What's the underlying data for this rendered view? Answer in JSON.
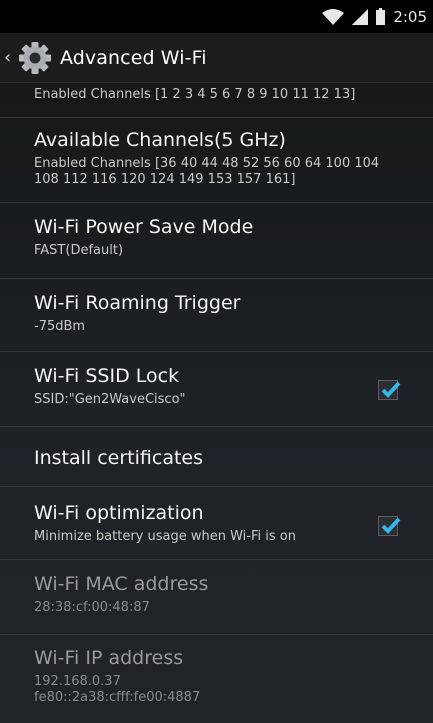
{
  "status": {
    "time": "2:05",
    "icons": [
      "wifi-icon",
      "signal-icon",
      "battery-icon"
    ]
  },
  "actionbar": {
    "title": "Advanced Wi-Fi",
    "icon": "settings-gear-icon"
  },
  "colors": {
    "accent": "#33b5e5",
    "background": "#1b1e22"
  },
  "settings": [
    {
      "title": "",
      "summary": "Enabled Channels [1 2 3 4 5 6 7 8 9 10 11 12 13]"
    },
    {
      "title": "Available Channels(5 GHz)",
      "summary": "Enabled Channels [36 40 44 48 52 56 60 64 100 104 108 112 116 120 124 149 153 157 161]"
    },
    {
      "title": "Wi-Fi Power Save Mode",
      "summary": "FAST(Default)"
    },
    {
      "title": "Wi-Fi Roaming Trigger",
      "summary": "-75dBm"
    },
    {
      "title": "Wi-Fi SSID Lock",
      "summary": "SSID:\"Gen2WaveCisco\"",
      "checked": true
    },
    {
      "title": "Install certificates",
      "summary": ""
    },
    {
      "title": "Wi-Fi optimization",
      "summary": "Minimize battery usage when Wi-Fi is on",
      "checked": true
    },
    {
      "title": "Wi-Fi MAC address",
      "summary": "28:38:cf:00:48:87"
    },
    {
      "title": "Wi-Fi IP address",
      "summary": "192.168.0.37",
      "summary2": "fe80::2a38:cfff:fe00:4887"
    }
  ]
}
